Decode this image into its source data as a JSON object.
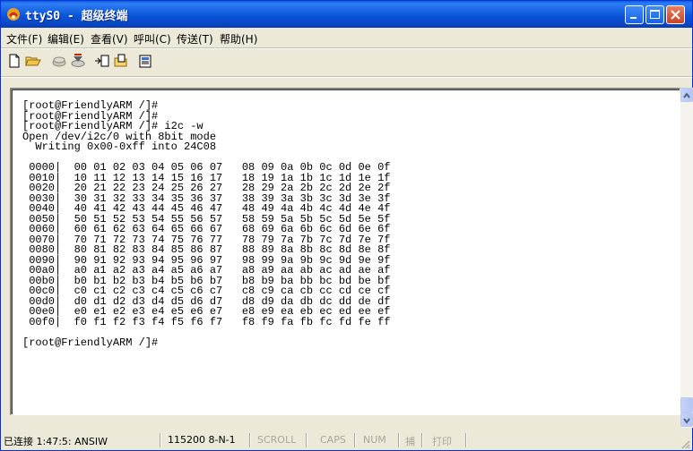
{
  "window": {
    "title": "ttyS0 - 超级终端"
  },
  "menu": [
    "文件(F)",
    "编辑(E)",
    "查看(V)",
    "呼叫(C)",
    "传送(T)",
    "帮助(H)"
  ],
  "icons": {
    "toolbar": [
      "new-document-icon",
      "open-folder-icon",
      "call-icon",
      "disconnect-icon",
      "send-icon",
      "receive-icon",
      "properties-icon"
    ]
  },
  "terminal": {
    "lines": [
      "[root@FriendlyARM /]#",
      "[root@FriendlyARM /]#",
      "[root@FriendlyARM /]# i2c -w",
      "Open /dev/i2c/0 with 8bit mode",
      "  Writing 0x00-0xff into 24C08",
      "",
      " 0000|  00 01 02 03 04 05 06 07   08 09 0a 0b 0c 0d 0e 0f",
      " 0010|  10 11 12 13 14 15 16 17   18 19 1a 1b 1c 1d 1e 1f",
      " 0020|  20 21 22 23 24 25 26 27   28 29 2a 2b 2c 2d 2e 2f",
      " 0030|  30 31 32 33 34 35 36 37   38 39 3a 3b 3c 3d 3e 3f",
      " 0040|  40 41 42 43 44 45 46 47   48 49 4a 4b 4c 4d 4e 4f",
      " 0050|  50 51 52 53 54 55 56 57   58 59 5a 5b 5c 5d 5e 5f",
      " 0060|  60 61 62 63 64 65 66 67   68 69 6a 6b 6c 6d 6e 6f",
      " 0070|  70 71 72 73 74 75 76 77   78 79 7a 7b 7c 7d 7e 7f",
      " 0080|  80 81 82 83 84 85 86 87   88 89 8a 8b 8c 8d 8e 8f",
      " 0090|  90 91 92 93 94 95 96 97   98 99 9a 9b 9c 9d 9e 9f",
      " 00a0|  a0 a1 a2 a3 a4 a5 a6 a7   a8 a9 aa ab ac ad ae af",
      " 00b0|  b0 b1 b2 b3 b4 b5 b6 b7   b8 b9 ba bb bc bd be bf",
      " 00c0|  c0 c1 c2 c3 c4 c5 c6 c7   c8 c9 ca cb cc cd ce cf",
      " 00d0|  d0 d1 d2 d3 d4 d5 d6 d7   d8 d9 da db dc dd de df",
      " 00e0|  e0 e1 e2 e3 e4 e5 e6 e7   e8 e9 ea eb ec ed ee ef",
      " 00f0|  f0 f1 f2 f3 f4 f5 f6 f7   f8 f9 fa fb fc fd fe ff",
      "",
      "[root@FriendlyARM /]#"
    ]
  },
  "status": {
    "connected": "已连接 1:47:5: ANSIW",
    "port_settings": "115200 8-N-1",
    "scroll": "SCROLL",
    "caps": "CAPS",
    "num": "NUM",
    "capture": "捕",
    "print": "打印"
  },
  "colors": {
    "titlebar": "#0b55d8",
    "close": "#c8432b",
    "chrome": "#ece9d8"
  }
}
